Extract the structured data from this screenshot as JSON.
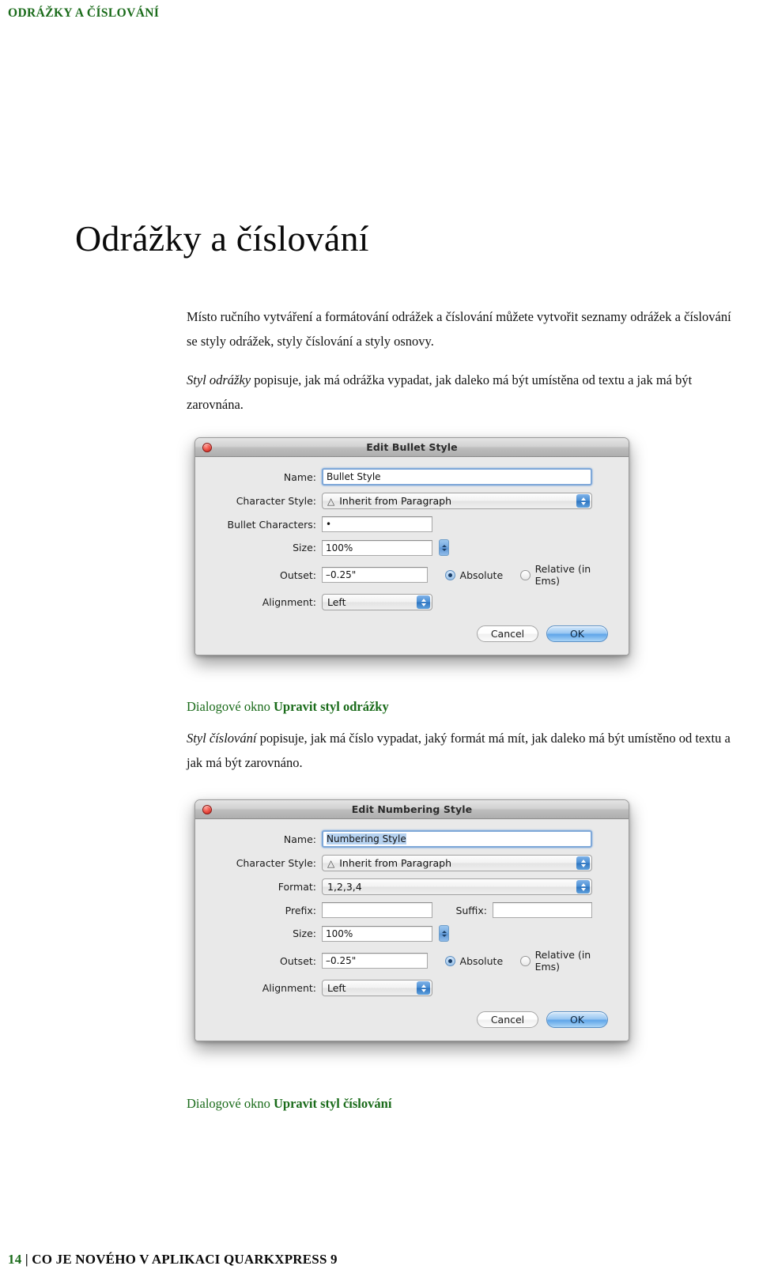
{
  "running_head": "ODRÁŽKY A ČÍSLOVÁNÍ",
  "page_title": "Odrážky a číslování",
  "colors": {
    "accent_green": "#1a6b1a",
    "text_black": "#0a0a0a",
    "dialog_bg": "#e9e9e9",
    "ok_blue": "#5fa5e8"
  },
  "body": {
    "para1_line1": "Místo ručního vytváření a formátování odrážek a číslování můžete vytvořit seznamy odrážek a",
    "para1_line2": "číslování se styly odrážek, styly číslování a styly osnovy.",
    "para2_italic": "Styl odrážky",
    "para2_rest": " popisuje, jak má odrážka vypadat, jak daleko má být umístěna od textu a jak má být zarovnána.",
    "para3_italic": "Styl číslování",
    "para3_rest": " popisuje, jak má číslo vypadat, jaký formát má mít, jak daleko má být umístěno od textu a jak má být zarovnáno."
  },
  "caption1": {
    "prefix": "Dialogové okno ",
    "bold": "Upravit styl odrážky"
  },
  "caption2": {
    "prefix": "Dialogové okno ",
    "bold": "Upravit styl číslování"
  },
  "dialog_bullet": {
    "title": "Edit Bullet Style",
    "close_icon": "close-window-icon",
    "labels": {
      "name": "Name:",
      "character_style": "Character Style:",
      "bullet_characters": "Bullet Characters:",
      "size": "Size:",
      "outset": "Outset:",
      "alignment": "Alignment:"
    },
    "values": {
      "name": "Bullet Style",
      "character_style": "Inherit from Paragraph",
      "bullet_characters": "•",
      "size": "100%",
      "outset": "–0.25\"",
      "alignment": "Left"
    },
    "radios": {
      "absolute": "Absolute",
      "relative": "Relative (in Ems)",
      "selected": "Absolute"
    },
    "buttons": {
      "cancel": "Cancel",
      "ok": "OK"
    }
  },
  "dialog_numbering": {
    "title": "Edit Numbering Style",
    "close_icon": "close-window-icon",
    "labels": {
      "name": "Name:",
      "character_style": "Character Style:",
      "format": "Format:",
      "prefix": "Prefix:",
      "suffix": "Suffix:",
      "size": "Size:",
      "outset": "Outset:",
      "alignment": "Alignment:"
    },
    "values": {
      "name": "Numbering Style",
      "character_style": "Inherit from Paragraph",
      "format": "1,2,3,4",
      "prefix": "",
      "suffix": "",
      "size": "100%",
      "outset": "–0.25\"",
      "alignment": "Left"
    },
    "radios": {
      "absolute": "Absolute",
      "relative": "Relative (in Ems)",
      "selected": "Absolute"
    },
    "buttons": {
      "cancel": "Cancel",
      "ok": "OK"
    }
  },
  "footer": {
    "page_number": "14",
    "separator": "|",
    "title": "CO JE NOVÉHO V APLIKACI QUARKXPRESS 9"
  }
}
